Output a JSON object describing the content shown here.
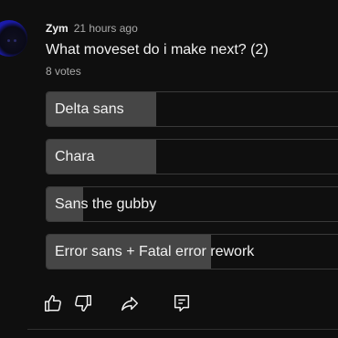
{
  "post": {
    "author": "Zym",
    "timestamp": "21 hours ago",
    "question": "What moveset do i make next? (2)",
    "votes": "8 votes"
  },
  "poll": {
    "options": [
      {
        "label": "Delta sans",
        "share": 0.375
      },
      {
        "label": "Chara",
        "share": 0.375
      },
      {
        "label": "Sans the gubby",
        "share": 0.125
      },
      {
        "label": "Error sans + Fatal error rework",
        "share": 0.5625
      }
    ]
  },
  "actions": [
    {
      "icon": "thumbs-up-icon"
    },
    {
      "icon": "thumbs-down-icon"
    },
    {
      "icon": "share-icon"
    },
    {
      "icon": "comment-icon"
    }
  ],
  "colors": {
    "background": "#0f0f0f",
    "fill": "#464646",
    "border": "#3a3a3a",
    "text": "#f1f1f1",
    "muted": "#aaaaaa"
  }
}
